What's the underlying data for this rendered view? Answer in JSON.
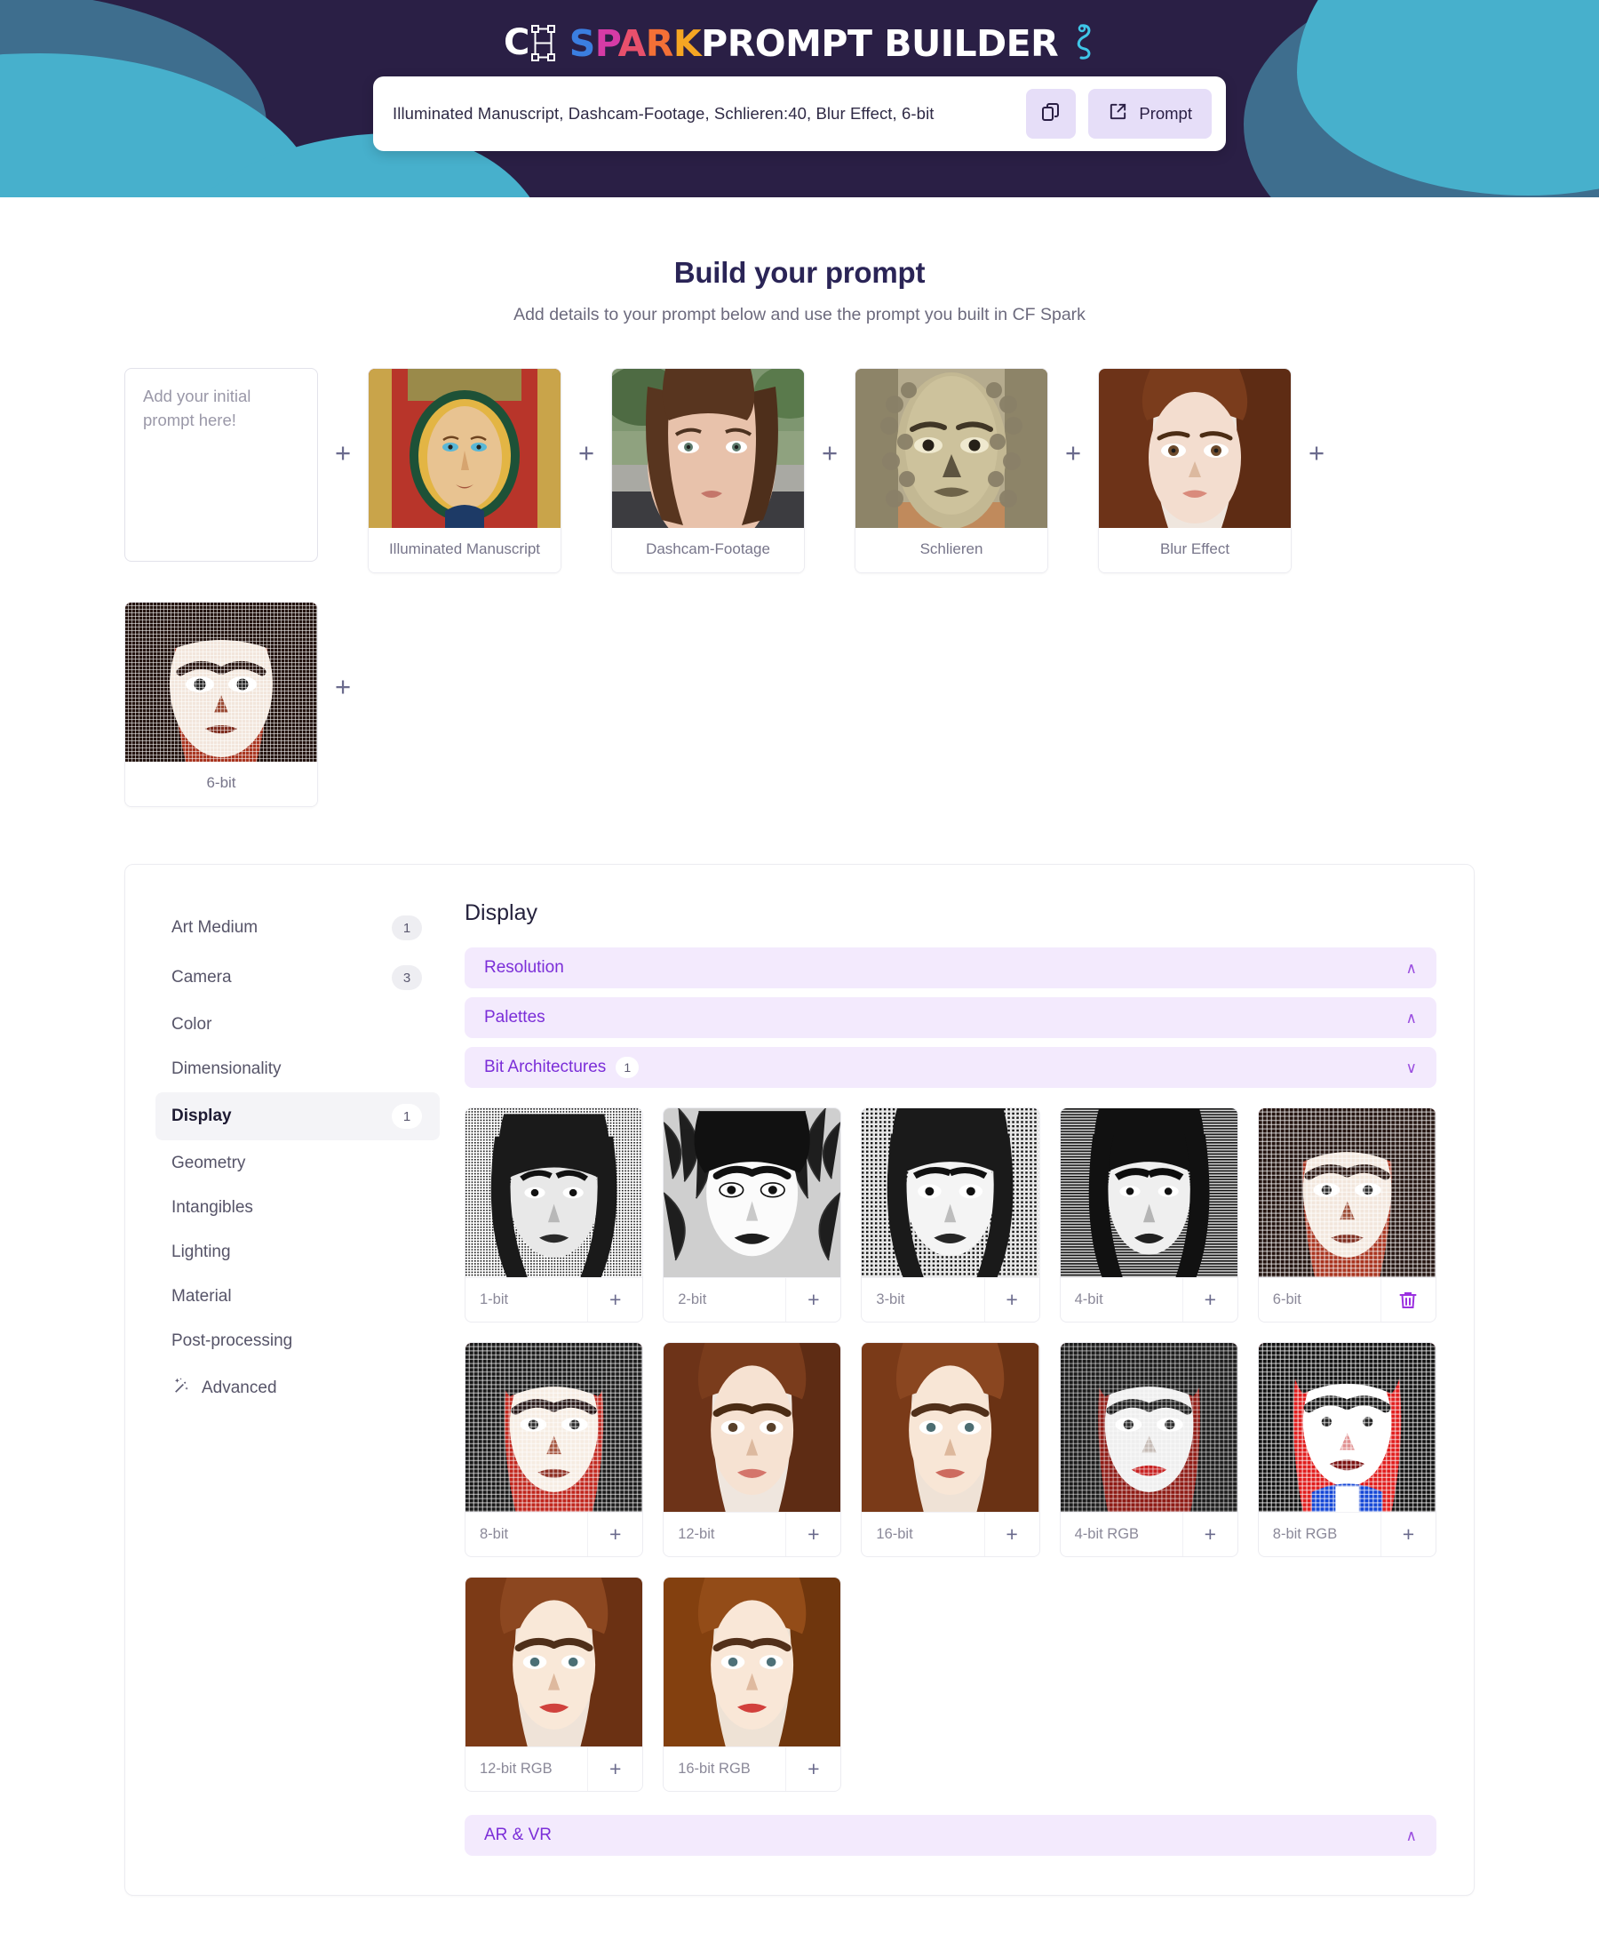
{
  "brand": {
    "logo_icon": "cf-spark-logo-icon",
    "word_spark": "SPARK",
    "word_rest": "PROMPT BUILDER",
    "colors": {
      "banner_bg": "#2a1f45",
      "blob_teal": "#47b0cc",
      "blob_blue": "#3e6e8e",
      "accent_purple": "#7b2ed8",
      "button_lilac": "#e6def8"
    }
  },
  "prompt_bar": {
    "value": "Illuminated Manuscript, Dashcam-Footage, Schlieren:40, Blur Effect, 6-bit",
    "copy_icon": "copy-icon",
    "external_icon": "external-link-icon",
    "prompt_button_label": "Prompt"
  },
  "header": {
    "title": "Build your prompt",
    "subtitle": "Add details to your prompt below and use the prompt you built in CF Spark"
  },
  "builder": {
    "initial_prompt_placeholder": "Add your initial prompt here!",
    "initial_prompt_value": "",
    "plus_glyph": "+",
    "cards": [
      {
        "label": "Illuminated Manuscript",
        "thumb": "illuminated-manuscript-thumb"
      },
      {
        "label": "Dashcam-Footage",
        "thumb": "dashcam-footage-thumb"
      },
      {
        "label": "Schlieren",
        "thumb": "schlieren-thumb"
      },
      {
        "label": "Blur Effect",
        "thumb": "blur-effect-thumb"
      },
      {
        "label": "6-bit",
        "thumb": "six-bit-thumb"
      }
    ]
  },
  "sidebar": {
    "items": [
      {
        "label": "Art Medium",
        "count": "1",
        "active": false,
        "icon": ""
      },
      {
        "label": "Camera",
        "count": "3",
        "active": false,
        "icon": ""
      },
      {
        "label": "Color",
        "count": "",
        "active": false,
        "icon": ""
      },
      {
        "label": "Dimensionality",
        "count": "",
        "active": false,
        "icon": ""
      },
      {
        "label": "Display",
        "count": "1",
        "active": true,
        "icon": ""
      },
      {
        "label": "Geometry",
        "count": "",
        "active": false,
        "icon": ""
      },
      {
        "label": "Intangibles",
        "count": "",
        "active": false,
        "icon": ""
      },
      {
        "label": "Lighting",
        "count": "",
        "active": false,
        "icon": ""
      },
      {
        "label": "Material",
        "count": "",
        "active": false,
        "icon": ""
      },
      {
        "label": "Post-processing",
        "count": "",
        "active": false,
        "icon": ""
      },
      {
        "label": "Advanced",
        "count": "",
        "active": false,
        "icon": "magic-wand-icon"
      }
    ]
  },
  "display_panel": {
    "section_title": "Display",
    "accordions": [
      {
        "label": "Resolution",
        "count": "",
        "expanded": false,
        "chevron": "∧"
      },
      {
        "label": "Palettes",
        "count": "",
        "expanded": false,
        "chevron": "∧"
      },
      {
        "label": "Bit Architectures",
        "count": "1",
        "expanded": true,
        "chevron": "∨"
      }
    ],
    "footer_accordion": {
      "label": "AR & VR",
      "count": "",
      "expanded": false,
      "chevron": "∧"
    },
    "tiles": [
      {
        "label": "1-bit",
        "action": "add",
        "action_glyph": "+"
      },
      {
        "label": "2-bit",
        "action": "add",
        "action_glyph": "+"
      },
      {
        "label": "3-bit",
        "action": "add",
        "action_glyph": "+"
      },
      {
        "label": "4-bit",
        "action": "add",
        "action_glyph": "+"
      },
      {
        "label": "6-bit",
        "action": "remove",
        "action_glyph": "🗑"
      },
      {
        "label": "8-bit",
        "action": "add",
        "action_glyph": "+"
      },
      {
        "label": "12-bit",
        "action": "add",
        "action_glyph": "+"
      },
      {
        "label": "16-bit",
        "action": "add",
        "action_glyph": "+"
      },
      {
        "label": "4-bit RGB",
        "action": "add",
        "action_glyph": "+"
      },
      {
        "label": "8-bit RGB",
        "action": "add",
        "action_glyph": "+"
      },
      {
        "label": "12-bit RGB",
        "action": "add",
        "action_glyph": "+"
      },
      {
        "label": "16-bit RGB",
        "action": "add",
        "action_glyph": "+"
      }
    ]
  }
}
